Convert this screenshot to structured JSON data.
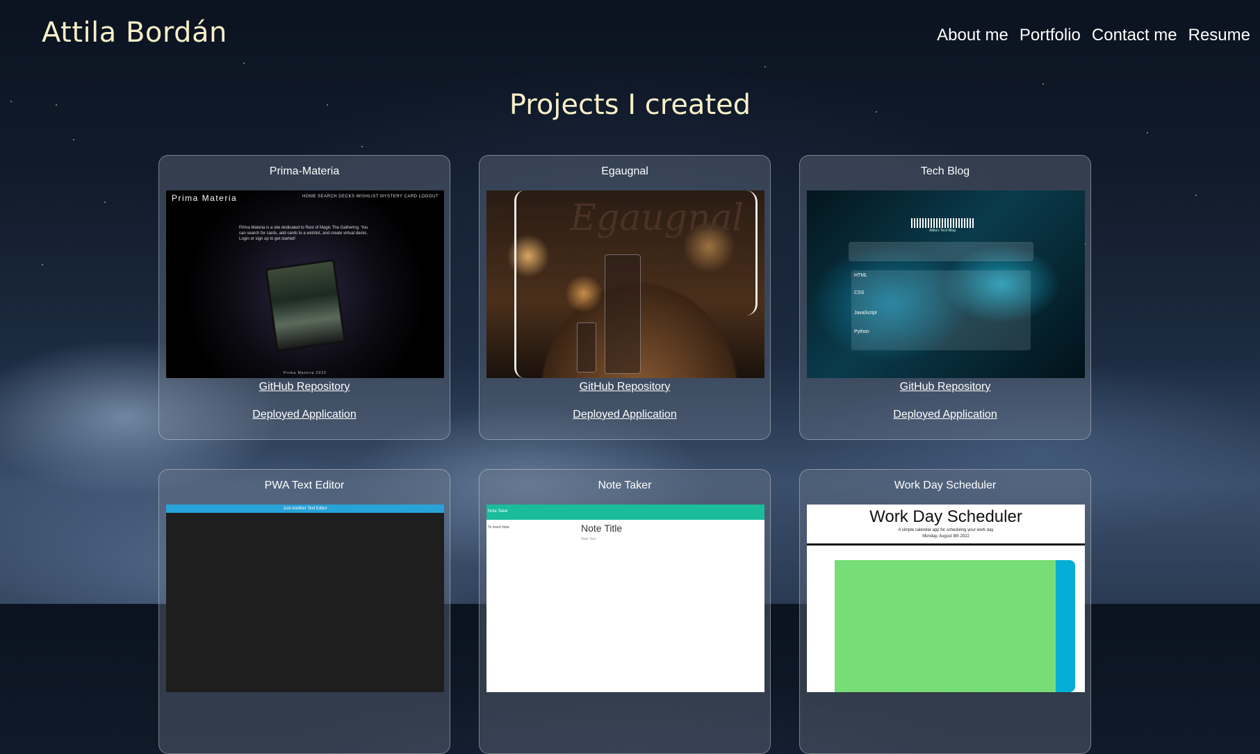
{
  "header": {
    "brand": "Attila Bordán",
    "nav": [
      {
        "label": "About me"
      },
      {
        "label": "Portfolio"
      },
      {
        "label": "Contact me"
      },
      {
        "label": "Resume"
      }
    ]
  },
  "section_title": "Projects I created",
  "projects": [
    {
      "title": "Prima-Materia",
      "repo_label": "GitHub Repository",
      "app_label": "Deployed Application",
      "thumb": {
        "site_name": "Prima Materia",
        "menu": "HOME   SEARCH   DECKS   WISHLIST   MYSTERY CARD   LOGOUT",
        "intro": "Prima Materia is a site dedicated to Rest of Magic The Gathering. You can search for cards, add cards to a wishlist, and create virtual decks. Login or sign up to get started!",
        "footer": "Prima Materia 2022"
      }
    },
    {
      "title": "Egaugnal",
      "repo_label": "GitHub Repository",
      "app_label": "Deployed Application",
      "thumb": {
        "logo": "Egaugnal"
      }
    },
    {
      "title": "Tech Blog",
      "repo_label": "GitHub Repository",
      "app_label": "Deployed Application",
      "thumb": {
        "subtitle": "Attila's Tech Blog",
        "items": [
          "HTML",
          "CSS",
          "JavaScript",
          "Python"
        ]
      }
    },
    {
      "title": "PWA Text Editor",
      "thumb": {
        "header": "Just Another Text Editor"
      }
    },
    {
      "title": "Note Taker",
      "thumb": {
        "app_name": "Note Taker",
        "side": "To insert Note",
        "note_title": "Note Title",
        "note_sub": "Note Text"
      }
    },
    {
      "title": "Work Day Scheduler",
      "thumb": {
        "heading": "Work Day Scheduler",
        "tagline": "A simple calendar app for scheduling your work day",
        "date": "Monday, August 8th 2022"
      }
    }
  ]
}
